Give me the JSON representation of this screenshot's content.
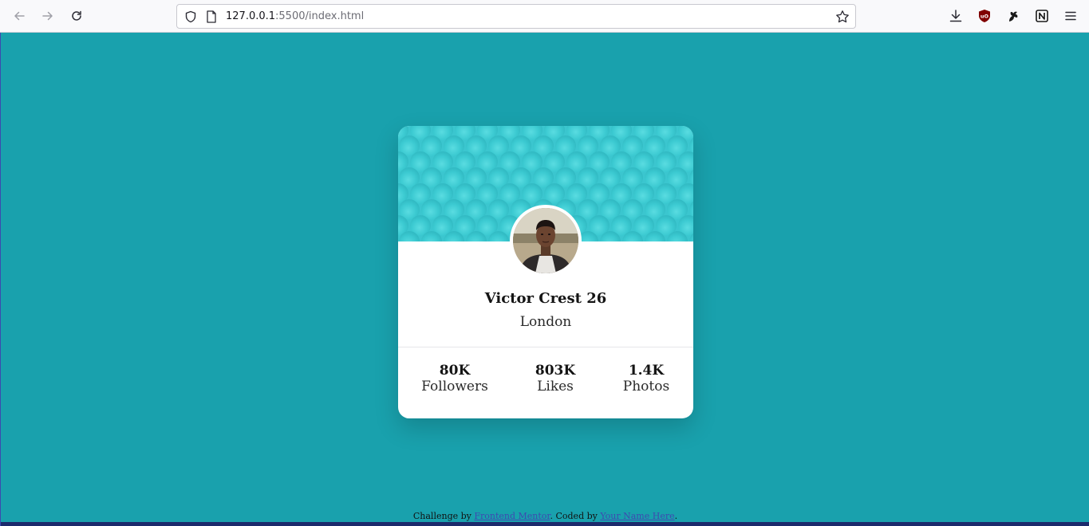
{
  "browser": {
    "url_host": "127.0.0.1",
    "url_rest": ":5500/index.html"
  },
  "profile": {
    "name": "Victor Crest 26",
    "location": "London",
    "stats": [
      {
        "value": "80K",
        "label": "Followers"
      },
      {
        "value": "803K",
        "label": "Likes"
      },
      {
        "value": "1.4K",
        "label": "Photos"
      }
    ]
  },
  "footer": {
    "prefix": "Challenge by ",
    "link1": "Frontend Mentor",
    "middle": ". Coded by ",
    "link2": "Your Name Here",
    "suffix": "."
  },
  "colors": {
    "page_bg": "#19a1ad",
    "header_bg": "#3bc6cf",
    "card_bg": "#ffffff"
  },
  "icons": [
    "back-icon",
    "forward-icon",
    "reload-icon",
    "shield-icon",
    "page-icon",
    "bookmark-star-icon",
    "download-icon",
    "ublock-icon",
    "extension-icon",
    "notion-icon",
    "menu-icon"
  ]
}
